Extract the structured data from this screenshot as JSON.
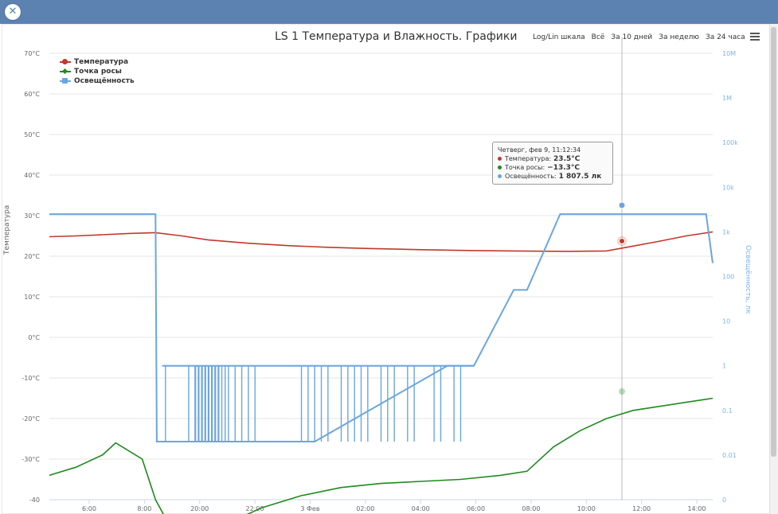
{
  "window": {
    "close_icon": "close-icon",
    "accent": "#5b82b0"
  },
  "title": "LS 1 Температура и Влажность. Графики",
  "toolbar": {
    "loglin": "Log/Lin шкала",
    "all": "Всё",
    "ten_days": "За 10 дней",
    "week": "За неделю",
    "day": "За 24 часа",
    "menu_icon": "menu-icon"
  },
  "legend": [
    {
      "name": "Температура",
      "color": "#c0392b"
    },
    {
      "name": "Точка росы",
      "color": "#1f8a1f"
    },
    {
      "name": "Освещённость",
      "color": "#6aa6de"
    }
  ],
  "left_axis_title": "Температура",
  "right_axis_title": "Освещённость, лк",
  "tooltip": {
    "header": "Четверг, фев 9, 11:12:34",
    "rows": [
      {
        "label": "Температура:",
        "value": "23.5°C",
        "color": "#c0392b"
      },
      {
        "label": "Точка росы:",
        "value": "−13.3°C",
        "color": "#1f8a1f"
      },
      {
        "label": "Освещённость:",
        "value": "1 807.5 лк",
        "color": "#6aa6de"
      }
    ]
  },
  "chart_data": {
    "type": "line",
    "title": "LS 1 Температура и Влажность. Графики",
    "x_ticks": [
      "6:00",
      "8:00",
      "20:00",
      "22:00",
      "3 Фев",
      "02:00",
      "04:00",
      "06:00",
      "08:00",
      "10:00",
      "12:00",
      "14:00"
    ],
    "left_ticks": [
      "70°C",
      "60°C",
      "50°C",
      "40°C",
      "30°C",
      "20°C",
      "10°C",
      "0°C",
      "-10°C",
      "-20°C",
      "-30°C",
      "-40"
    ],
    "right_ticks": [
      "10M",
      "1M",
      "100k",
      "10k",
      "1k",
      "100",
      "10",
      "1",
      "0.1",
      "0.01",
      "0"
    ],
    "ylim_left": [
      -40,
      70
    ],
    "right_scale": "log",
    "grid": true,
    "legend_position": "top-left",
    "series": [
      {
        "name": "Температура",
        "axis": "left",
        "color": "#c0392b",
        "x": [
          0,
          4,
          8,
          12,
          16,
          20,
          24,
          30,
          36,
          42,
          48,
          56,
          64,
          70,
          78,
          84,
          88,
          92,
          96,
          100
        ],
        "values": [
          24.8,
          25.0,
          25.3,
          25.6,
          25.8,
          25.0,
          24.0,
          23.2,
          22.6,
          22.2,
          21.9,
          21.6,
          21.4,
          21.3,
          21.2,
          21.3,
          22.5,
          23.7,
          25.0,
          26.0
        ]
      },
      {
        "name": "Точка росы",
        "axis": "left",
        "color": "#1f8a1f",
        "x": [
          0,
          4,
          8,
          10,
          12,
          14,
          16,
          18,
          21,
          24,
          28,
          32,
          38,
          44,
          50,
          56,
          62,
          68,
          72,
          76,
          80,
          84,
          88,
          92,
          96,
          100
        ],
        "values": [
          -34,
          -32,
          -29,
          -26,
          -28,
          -30,
          -40,
          -46,
          -47,
          -46,
          -45,
          -42,
          -39,
          -37,
          -36,
          -35.5,
          -35,
          -34,
          -33,
          -27,
          -23,
          -20,
          -18,
          -17,
          -16,
          -15
        ]
      },
      {
        "name": "Освещённость",
        "axis": "right",
        "color": "#6aa6de",
        "x": [
          0,
          16,
          16.2,
          40,
          60,
          64,
          70,
          72,
          77,
          77.2,
          99,
          100
        ],
        "values": [
          2500,
          2500,
          0.02,
          0.02,
          1,
          1,
          50,
          50,
          2500,
          2500,
          2500,
          200
        ]
      }
    ]
  }
}
